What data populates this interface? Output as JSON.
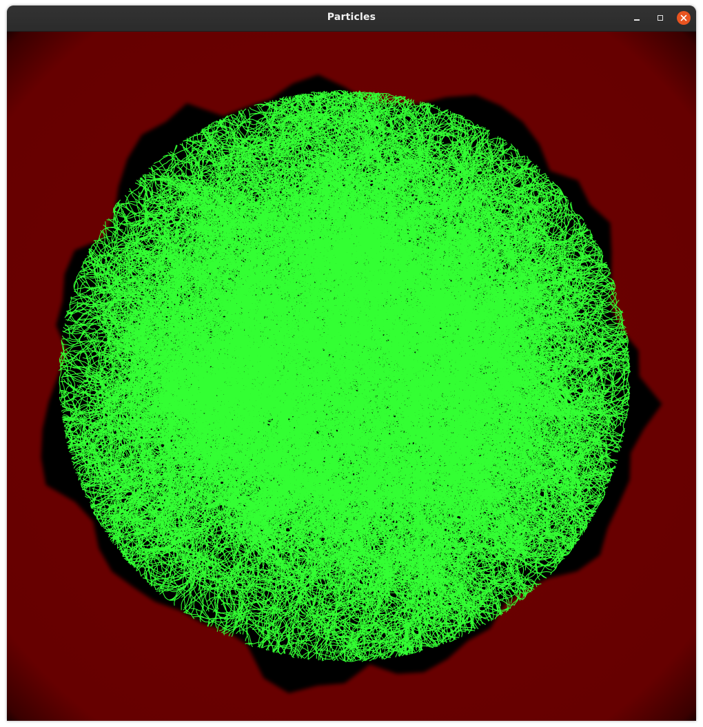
{
  "window": {
    "title": "Particles",
    "controls": {
      "minimize": "minimize-icon",
      "maximize": "maximize-icon",
      "close": "close-icon"
    }
  },
  "scene": {
    "background_color": "#6b0000",
    "cluster_color": "#000000",
    "particle_color": "#33ff33",
    "description_icon": "diffusion-limited-aggregation"
  }
}
